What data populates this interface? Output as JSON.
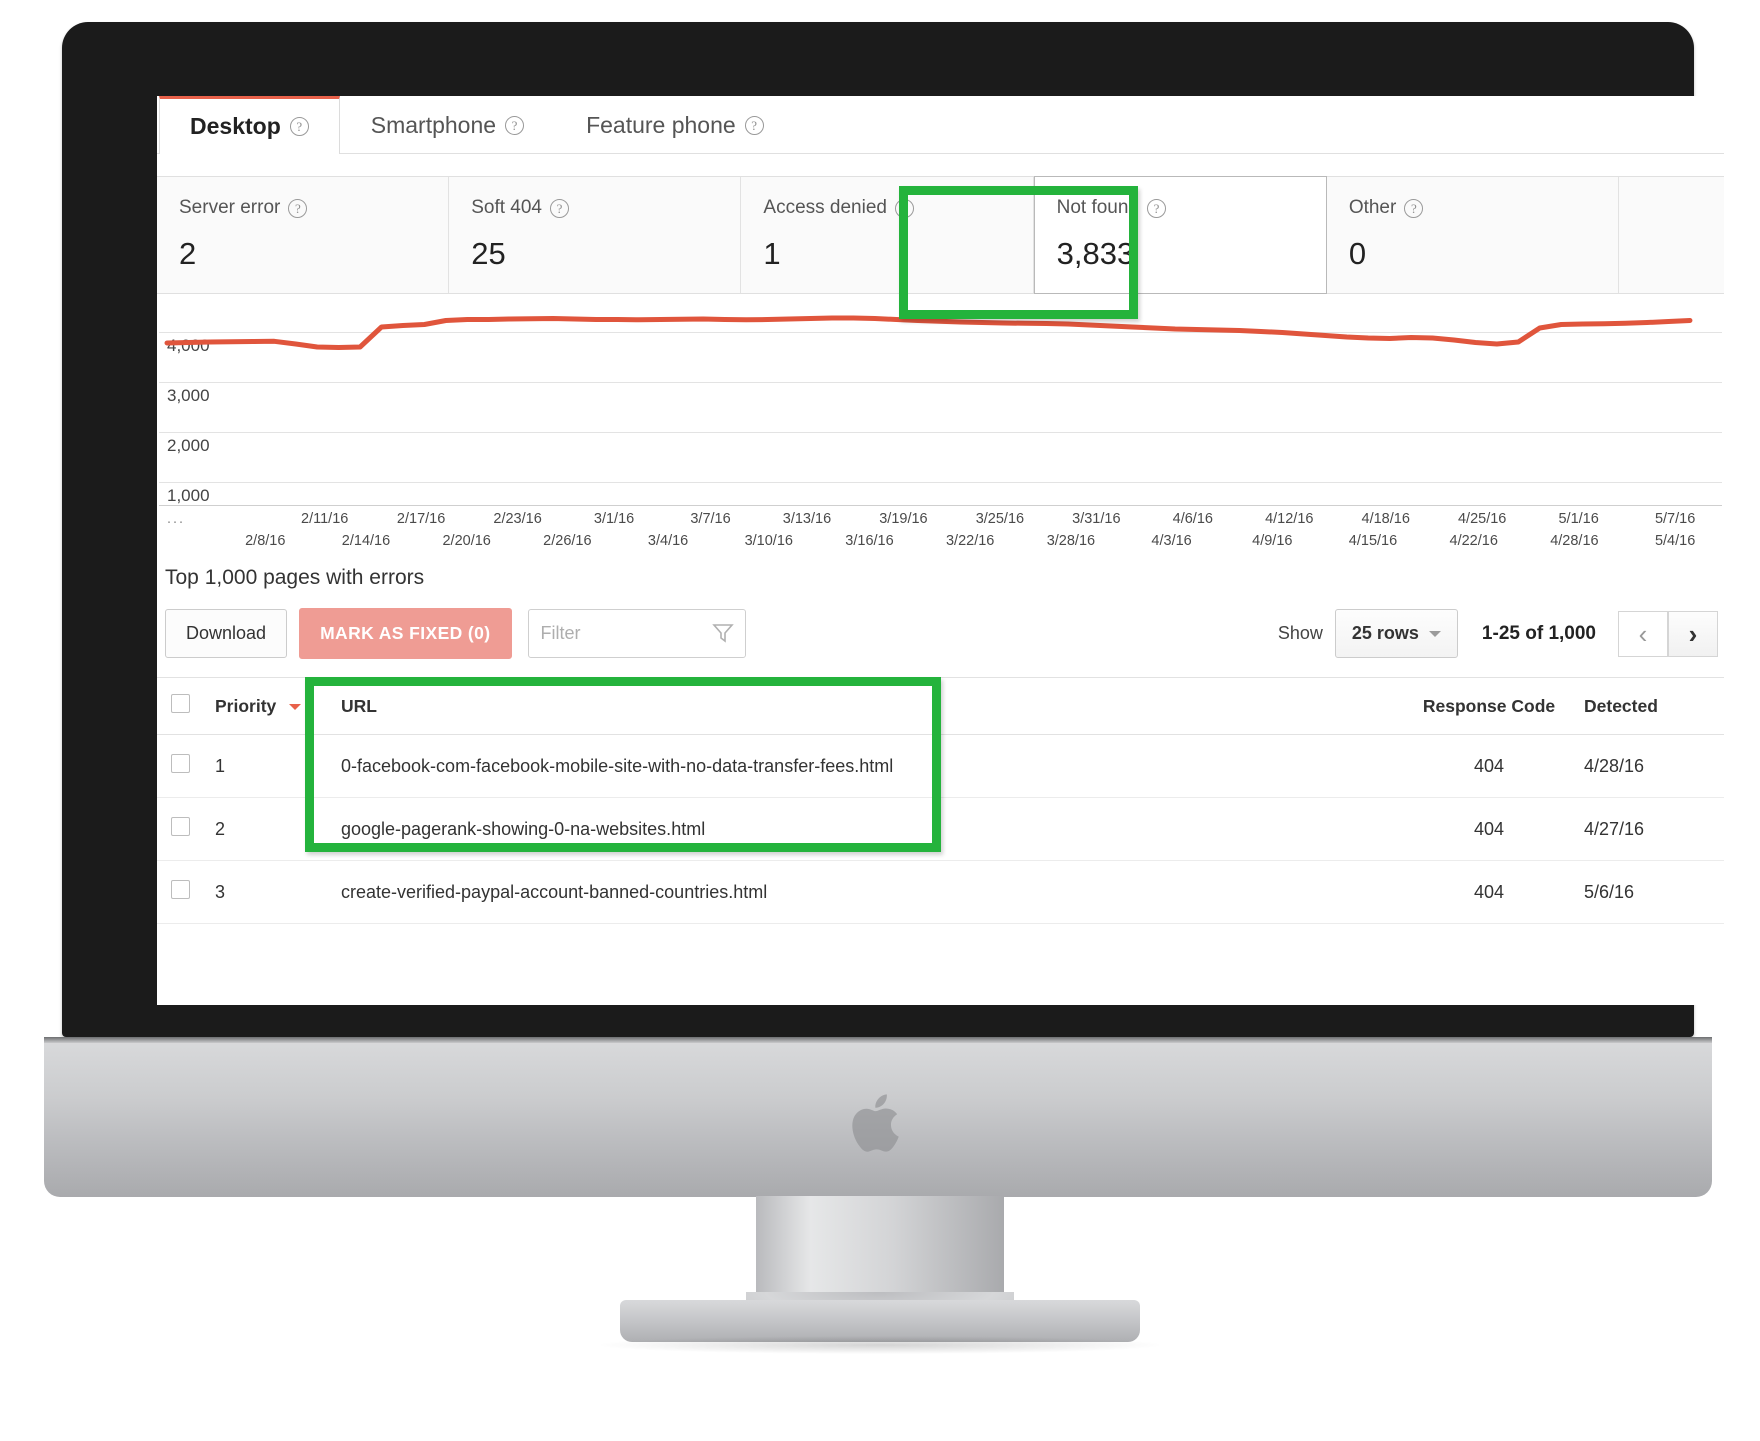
{
  "tabs": [
    {
      "label": "Desktop",
      "active": true
    },
    {
      "label": "Smartphone",
      "active": false
    },
    {
      "label": "Feature phone",
      "active": false
    }
  ],
  "cards": [
    {
      "label": "Server error",
      "value": "2",
      "selected": false
    },
    {
      "label": "Soft 404",
      "value": "25",
      "selected": false
    },
    {
      "label": "Access denied",
      "value": "1",
      "selected": false
    },
    {
      "label": "Not found",
      "value": "3,833",
      "selected": true
    },
    {
      "label": "Other",
      "value": "0",
      "selected": false
    }
  ],
  "chart_data": {
    "type": "line",
    "title": "",
    "xlabel": "",
    "ylabel": "",
    "ylim": [
      0,
      5000
    ],
    "grid": true,
    "legend": "none",
    "line_color": "#e0553c",
    "y_ticks": [
      4000,
      3000,
      2000,
      1000
    ],
    "y_tick_labels": [
      "4,000",
      "3,000",
      "2,000",
      "1,000"
    ],
    "x_labels_top": [
      "2/11/16",
      "2/17/16",
      "2/23/16",
      "3/1/16",
      "3/7/16",
      "3/13/16",
      "3/19/16",
      "3/25/16",
      "3/31/16",
      "4/6/16",
      "4/12/16",
      "4/18/16",
      "4/25/16",
      "5/1/16",
      "5/7/16"
    ],
    "x_labels_bottom": [
      "2/8/16",
      "2/14/16",
      "2/20/16",
      "2/26/16",
      "3/4/16",
      "3/10/16",
      "3/16/16",
      "3/22/16",
      "3/28/16",
      "4/3/16",
      "4/9/16",
      "4/15/16",
      "4/22/16",
      "4/28/16",
      "5/4/16"
    ],
    "x_leading_ellipsis": "...",
    "values": [
      3780,
      3790,
      3800,
      3805,
      3810,
      3815,
      3760,
      3700,
      3690,
      3700,
      4100,
      4130,
      4150,
      4230,
      4250,
      4250,
      4260,
      4265,
      4270,
      4260,
      4250,
      4250,
      4245,
      4250,
      4255,
      4260,
      4250,
      4245,
      4250,
      4260,
      4270,
      4280,
      4280,
      4270,
      4250,
      4230,
      4215,
      4200,
      4190,
      4180,
      4175,
      4170,
      4160,
      4140,
      4120,
      4100,
      4080,
      4060,
      4050,
      4040,
      4030,
      4010,
      3990,
      3960,
      3930,
      3900,
      3880,
      3870,
      3890,
      3880,
      3840,
      3790,
      3760,
      3800,
      4080,
      4150,
      4160,
      4165,
      4175,
      4190,
      4210,
      4230
    ]
  },
  "table_section": {
    "title": "Top 1,000 pages with errors",
    "download_label": "Download",
    "mark_fixed_label": "MARK AS FIXED (0)",
    "filter_placeholder": "Filter",
    "filter_value": "",
    "show_label": "Show",
    "rows_select_value": "25 rows",
    "range_label": "1-25 of 1,000",
    "prev_icon": "chevron-left-icon",
    "next_icon": "chevron-right-icon",
    "columns": [
      "",
      "Priority",
      "URL",
      "Response Code",
      "Detected"
    ],
    "sorted_column": "Priority",
    "rows": [
      {
        "priority": "1",
        "url": "0-facebook-com-facebook-mobile-site-with-no-data-transfer-fees.html",
        "code": "404",
        "detected": "4/28/16"
      },
      {
        "priority": "2",
        "url": "google-pagerank-showing-0-na-websites.html",
        "code": "404",
        "detected": "4/27/16"
      },
      {
        "priority": "3",
        "url": "create-verified-paypal-account-banned-countries.html",
        "code": "404",
        "detected": "5/6/16"
      }
    ]
  },
  "highlights": {
    "color": "#24b33c",
    "card_target": "Not found",
    "table_target": "URL column rows 1-3"
  }
}
